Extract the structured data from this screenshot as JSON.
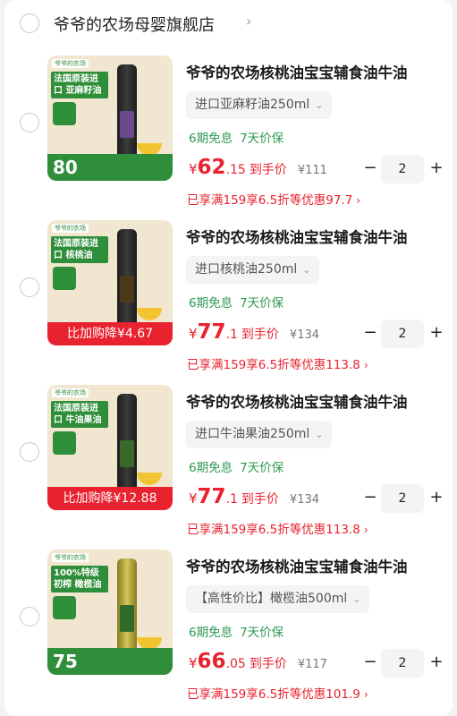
{
  "store": {
    "name": "爷爷的农场母婴旗舰店",
    "arrow": "›"
  },
  "items": [
    {
      "thumb": {
        "tag": "爷爷的农场",
        "headline": "法国原装进口 亚麻籽油",
        "bottom_text": "80",
        "bottom_label": ""
      },
      "title": "爷爷的农场核桃油宝宝辅食油牛油",
      "spec": "进口亚麻籽油250ml",
      "tags": [
        "6期免息",
        "7天价保"
      ],
      "price": {
        "currency": "¥",
        "integer": "62",
        "decimal": ".15",
        "label": "到手价",
        "original": "¥111"
      },
      "qty": "2",
      "promo": "已享满159享6.5折等优惠97.7"
    },
    {
      "thumb": {
        "tag": "爷爷的农场",
        "headline": "法国原装进口 核桃油",
        "bottom_text": "",
        "bottom_label": "比加购降¥4.67"
      },
      "title": "爷爷的农场核桃油宝宝辅食油牛油",
      "spec": "进口核桃油250ml",
      "tags": [
        "6期免息",
        "7天价保"
      ],
      "price": {
        "currency": "¥",
        "integer": "77",
        "decimal": ".1",
        "label": "到手价",
        "original": "¥134"
      },
      "qty": "2",
      "promo": "已享满159享6.5折等优惠113.8"
    },
    {
      "thumb": {
        "tag": "爷爷的农场",
        "headline": "法国原装进口 牛油果油",
        "bottom_text": "",
        "bottom_label": "比加购降¥12.88"
      },
      "title": "爷爷的农场核桃油宝宝辅食油牛油",
      "spec": "进口牛油果油250ml",
      "tags": [
        "6期免息",
        "7天价保"
      ],
      "price": {
        "currency": "¥",
        "integer": "77",
        "decimal": ".1",
        "label": "到手价",
        "original": "¥134"
      },
      "qty": "2",
      "promo": "已享满159享6.5折等优惠113.8"
    },
    {
      "thumb": {
        "tag": "爷爷的农场",
        "headline": "100%特级初榨 橄榄油",
        "bottom_text": "75",
        "bottom_label": ""
      },
      "title": "爷爷的农场核桃油宝宝辅食油牛油",
      "spec": "【高性价比】橄榄油500ml",
      "tags": [
        "6期免息",
        "7天价保"
      ],
      "price": {
        "currency": "¥",
        "integer": "66",
        "decimal": ".05",
        "label": "到手价",
        "original": "¥117"
      },
      "qty": "2",
      "promo": "已享满159享6.5折等优惠101.9"
    }
  ],
  "icons": {
    "minus": "−",
    "plus": "+",
    "chevron_down": "⌄",
    "chevron_right": "›"
  }
}
